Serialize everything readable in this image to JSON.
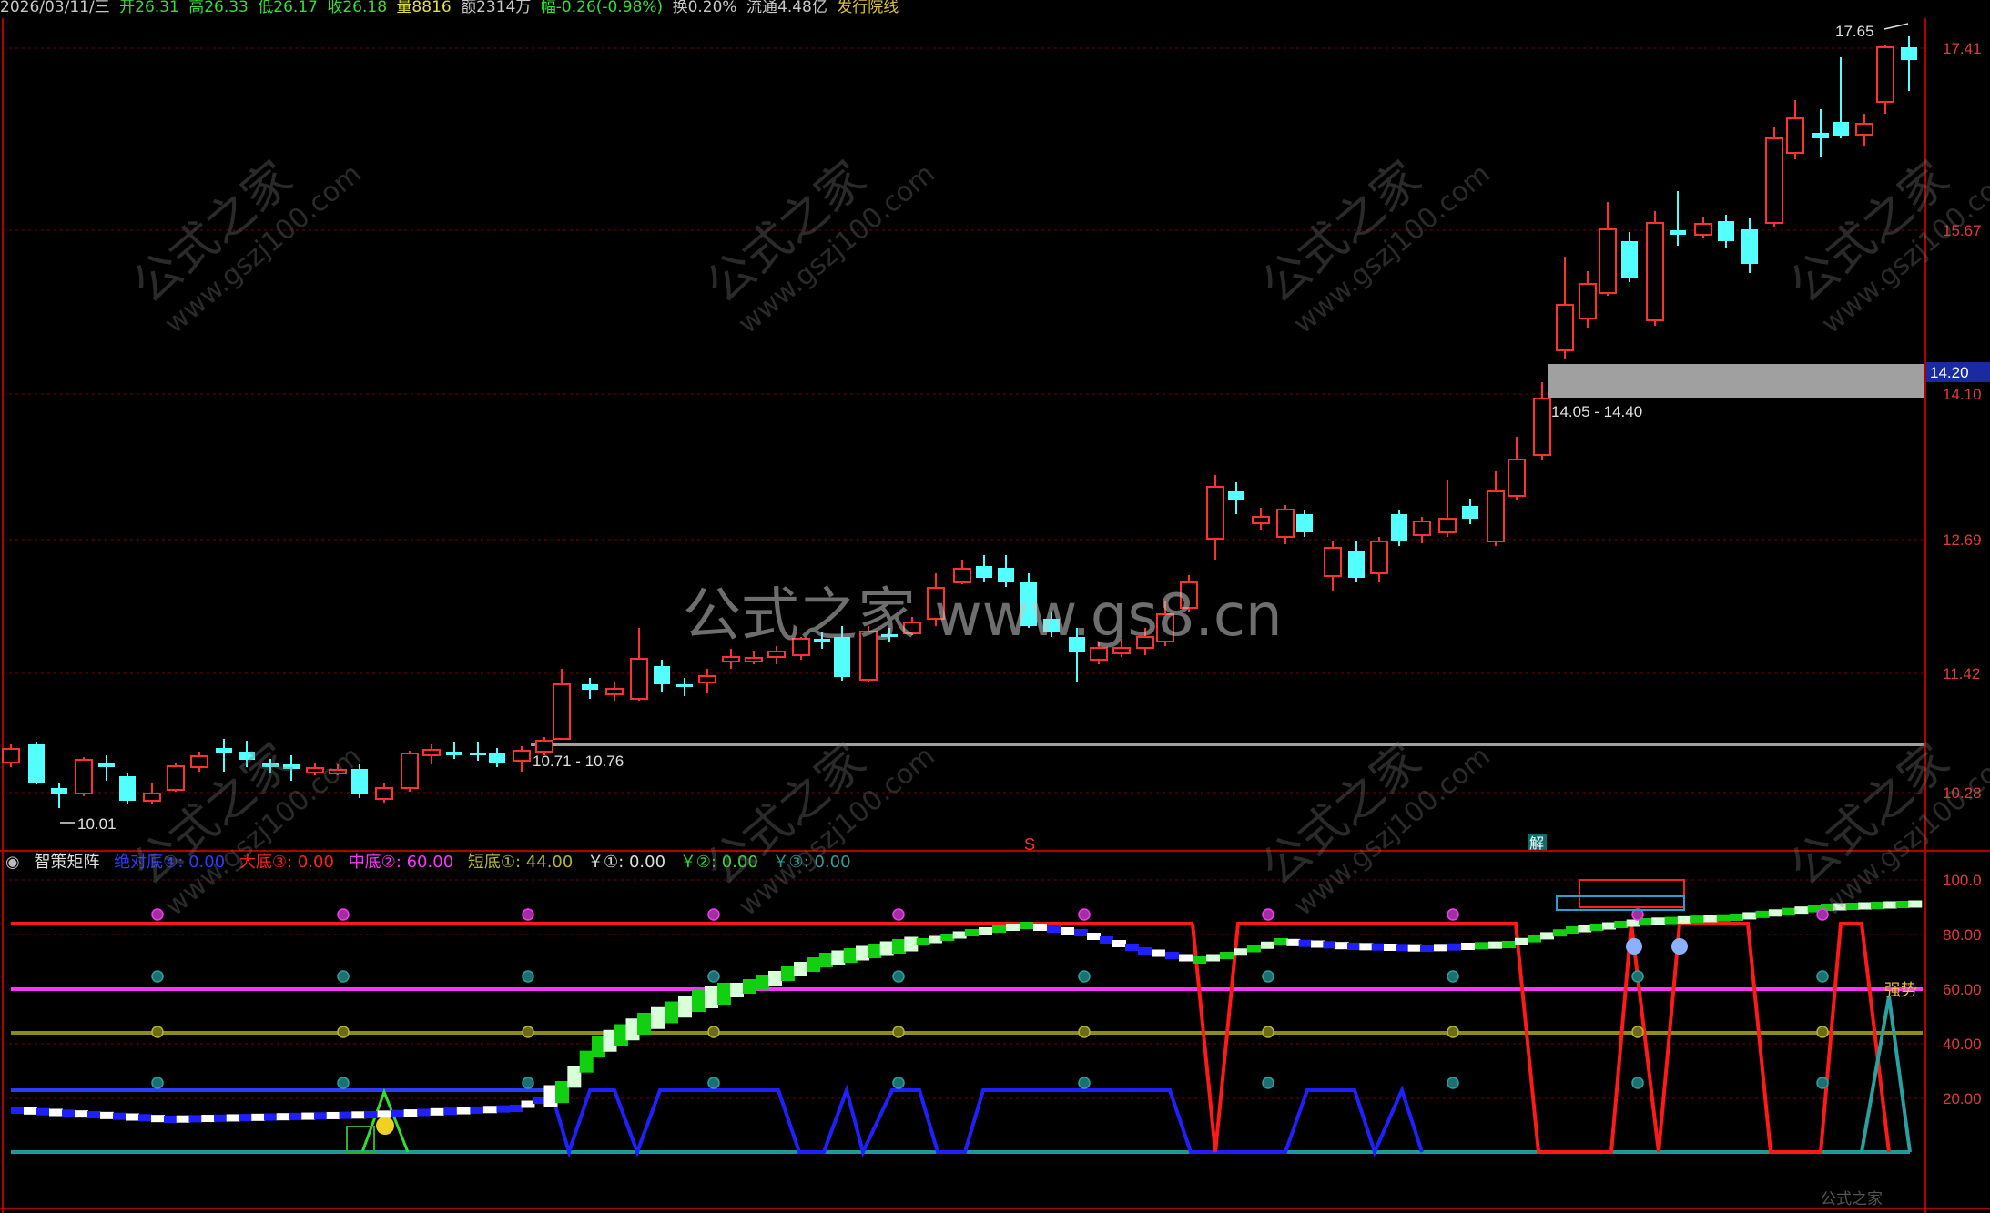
{
  "info_bar": {
    "date": "2026/03/11/三",
    "open": "开26.31",
    "high": "高26.33",
    "low": "低26.17",
    "close": "收26.18",
    "volume": "量8816",
    "amount": "额2314万",
    "change": "幅-0.26(-0.98%)",
    "turnover": "换0.20%",
    "float": "流通4.48亿",
    "indicator_name": "发行院线"
  },
  "price_axis": {
    "ticks": [
      "17.41",
      "15.67",
      "14.10",
      "12.69",
      "11.42",
      "10.28"
    ],
    "current_price": "14.20",
    "high_mark": "17.65",
    "low_mark": "10.01"
  },
  "zones": {
    "upper_zone_label": "14.05 - 14.40",
    "lower_zone_label": "10.71 - 10.76"
  },
  "markers": {
    "s_marker": "S",
    "jie_marker": "解"
  },
  "indicator": {
    "name": "智策矩阵",
    "items": [
      {
        "label": "绝对底④: 0.00",
        "color": "#2e3bff"
      },
      {
        "label": "大底③: 0.00",
        "color": "#ff2020"
      },
      {
        "label": "中底②: 60.00",
        "color": "#ff33ff"
      },
      {
        "label": "短底①: 44.00",
        "color": "#b5b534"
      },
      {
        "label": "￥①: 0.00",
        "color": "#dddddd"
      },
      {
        "label": "￥②: 0.00",
        "color": "#33dd33"
      },
      {
        "label": "￥③: 0.00",
        "color": "#2aa0a0"
      }
    ],
    "axis_ticks": [
      "100.0",
      "80.00",
      "60.00",
      "40.00",
      "20.00"
    ],
    "strong_label": "强势",
    "footer_mark": "公式之家"
  },
  "watermark": {
    "center": "公式之家 www.gs8.cn",
    "diag_cn": "公式之家",
    "diag_url": "www.gszj100.com"
  },
  "colors": {
    "up": "#ff3030",
    "down": "#54ffff",
    "axis": "#b00000",
    "grid": "#7a0000"
  }
}
